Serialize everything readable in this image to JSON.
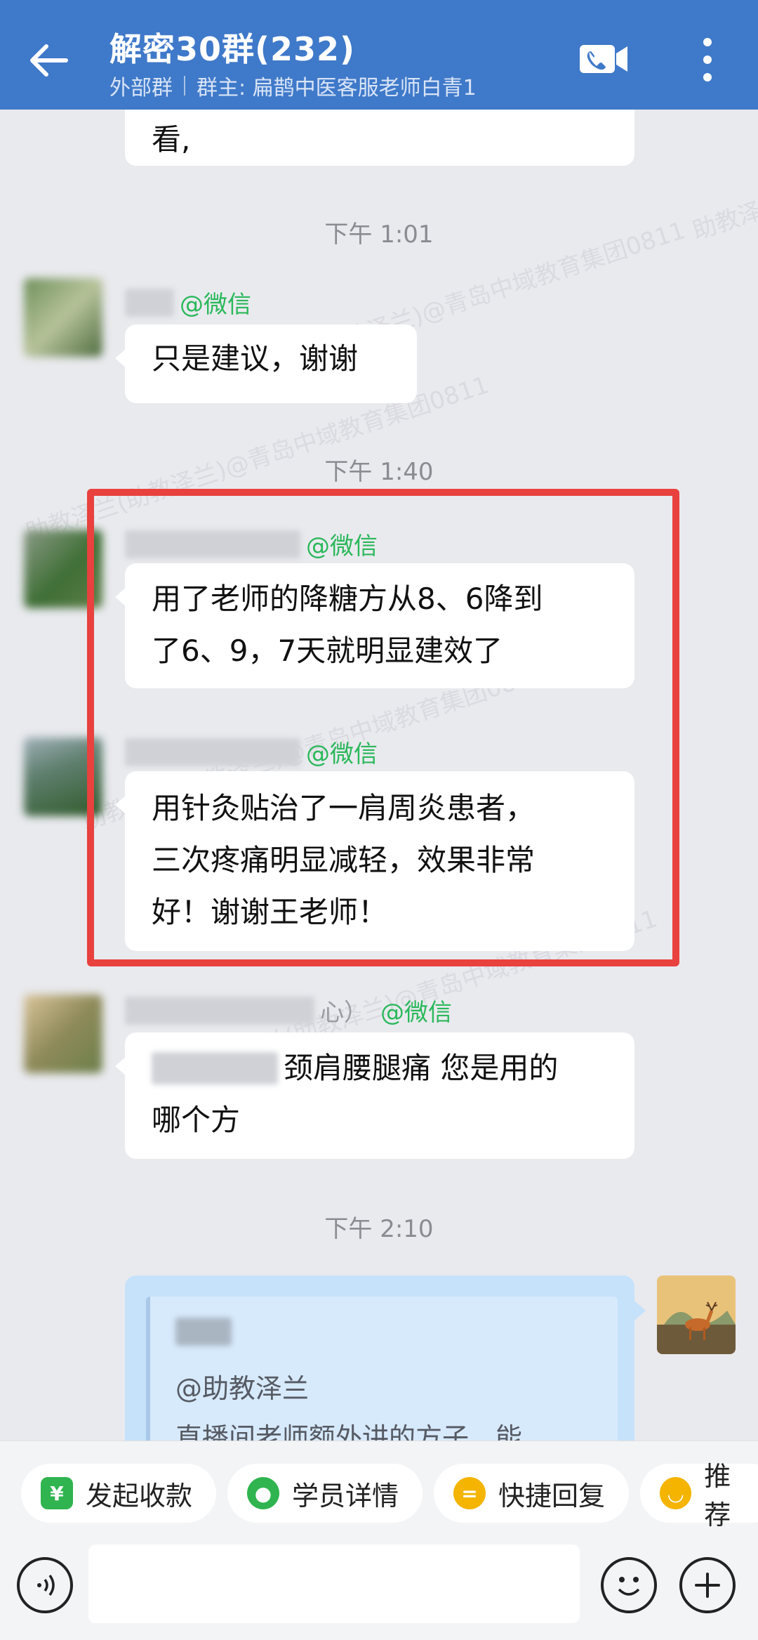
{
  "header": {
    "title": "解密30群(232)",
    "tag": "外部群",
    "owner": "群主: 扁鹊中医客服老师白青1"
  },
  "messages": {
    "m0_text": "看,",
    "time1": "下午 1:01",
    "m1_source": "@微信",
    "m1_text": "只是建议，谢谢",
    "time2": "下午 1:40",
    "m2_source": "@微信",
    "m2_line1": "用了老师的降糖方从8、6降到",
    "m2_line2": "了6、9，7天就明显建效了",
    "m3_source": "@微信",
    "m3_line1": "用针灸贴治了一肩周炎患者，",
    "m3_line2": "三次疼痛明显减轻，效果非常",
    "m3_line3": "好！谢谢王老师！",
    "m4_name_tail": "心）",
    "m4_source": "@微信",
    "m4_line1": "颈肩腰腿痛 您是用的",
    "m4_line2": "哪个方",
    "time3": "下午 2:10",
    "m5_quote_mention": "@助教泽兰",
    "m5_quote_text": "直播间老师额外讲的方子，能…"
  },
  "watermark_text": "助教泽兰(助教泽兰)@青岛中域教育集团0811",
  "quick_actions": [
    {
      "label": "发起收款",
      "icon": "payment-icon",
      "color": "#2fb44f"
    },
    {
      "label": "学员详情",
      "icon": "student-icon",
      "color": "#2fb44f"
    },
    {
      "label": "快捷回复",
      "icon": "quick-reply-icon",
      "color": "#f4b400"
    },
    {
      "label": "推荐",
      "icon": "recommend-icon",
      "color": "#f4b400"
    }
  ],
  "colors": {
    "header": "#3f79c9",
    "highlight": "#e8413e",
    "source_tag": "#2ab85a",
    "my_bubble": "#c6e2fb"
  }
}
